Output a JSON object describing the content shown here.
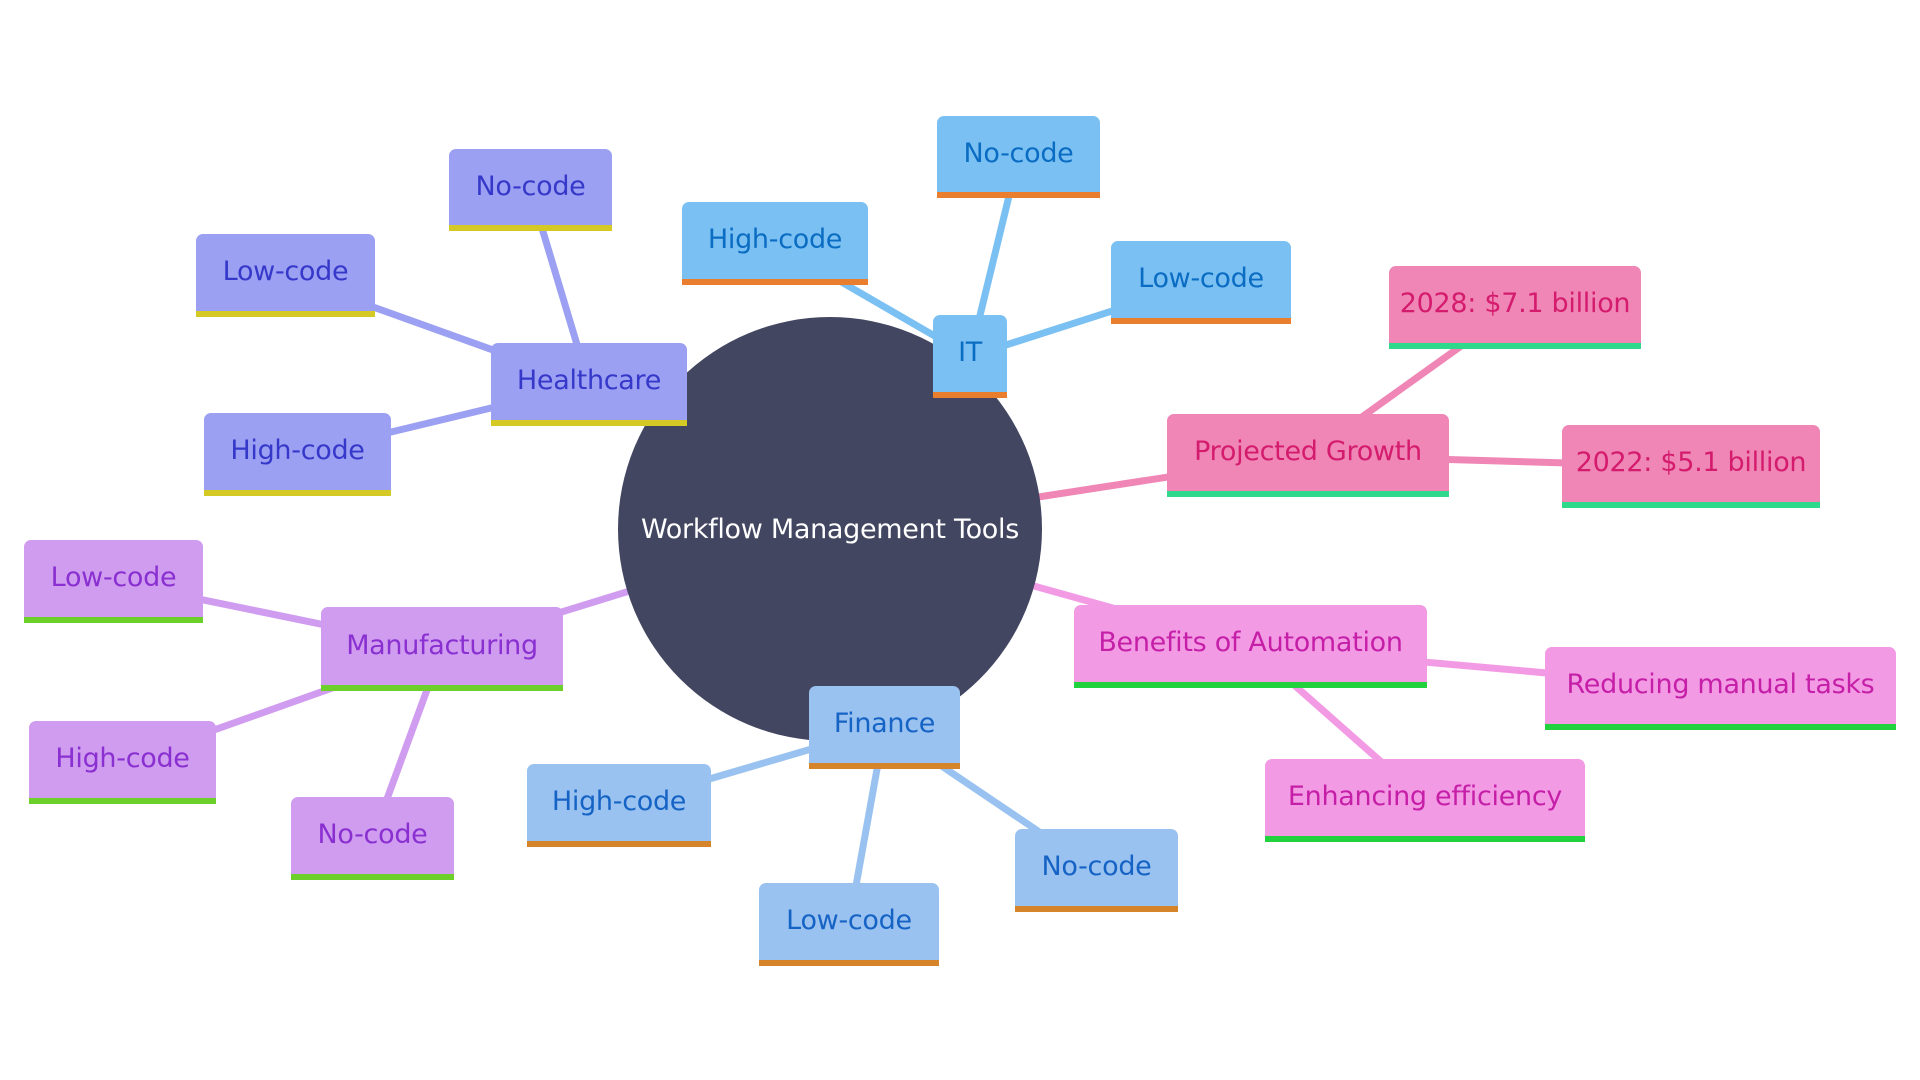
{
  "diagram": {
    "type": "mindmap",
    "root": {
      "label": "Workflow Management Tools",
      "fill": "#424660",
      "text_color": "#ffffff"
    },
    "branches": [
      {
        "id": "healthcare",
        "label": "Healthcare",
        "fill": "#9ca0f2",
        "text_color": "#3538c9",
        "bar": "#d4c925",
        "edge": "#9ca0f2",
        "children": [
          {
            "id": "hc-no-code",
            "label": "No-code"
          },
          {
            "id": "hc-low-code",
            "label": "Low-code"
          },
          {
            "id": "hc-high-code",
            "label": "High-code"
          }
        ]
      },
      {
        "id": "it",
        "label": "IT",
        "fill": "#7bc0f2",
        "text_color": "#0a6cc2",
        "bar": "#e87e2e",
        "edge": "#7bc0f2",
        "children": [
          {
            "id": "it-high-code",
            "label": "High-code"
          },
          {
            "id": "it-no-code",
            "label": "No-code"
          },
          {
            "id": "it-low-code",
            "label": "Low-code"
          }
        ]
      },
      {
        "id": "projected-growth",
        "label": "Projected Growth",
        "fill": "#ef86b5",
        "text_color": "#d41b6d",
        "bar": "#2fd98b",
        "edge": "#ef86b5",
        "children": [
          {
            "id": "pg-2028",
            "label": "2028: $7.1 billion"
          },
          {
            "id": "pg-2022",
            "label": "2022: $5.1 billion"
          }
        ]
      },
      {
        "id": "benefits",
        "label": "Benefits of Automation",
        "fill": "#f39ae5",
        "text_color": "#c51fa8",
        "bar": "#22d13e",
        "edge": "#f39ae5",
        "children": [
          {
            "id": "ben-reducing",
            "label": "Reducing manual tasks"
          },
          {
            "id": "ben-enhancing",
            "label": "Enhancing efficiency"
          }
        ]
      },
      {
        "id": "finance",
        "label": "Finance",
        "fill": "#9ac2f0",
        "text_color": "#1563c4",
        "bar": "#d6842a",
        "edge": "#9ac2f0",
        "children": [
          {
            "id": "fin-high-code",
            "label": "High-code"
          },
          {
            "id": "fin-low-code",
            "label": "Low-code"
          },
          {
            "id": "fin-no-code",
            "label": "No-code"
          }
        ]
      },
      {
        "id": "manufacturing",
        "label": "Manufacturing",
        "fill": "#cf9cf0",
        "text_color": "#8a2fd0",
        "bar": "#6ccf2a",
        "edge": "#cf9cf0",
        "children": [
          {
            "id": "mfg-low-code",
            "label": "Low-code"
          },
          {
            "id": "mfg-high-code",
            "label": "High-code"
          },
          {
            "id": "mfg-no-code",
            "label": "No-code"
          }
        ]
      }
    ]
  }
}
